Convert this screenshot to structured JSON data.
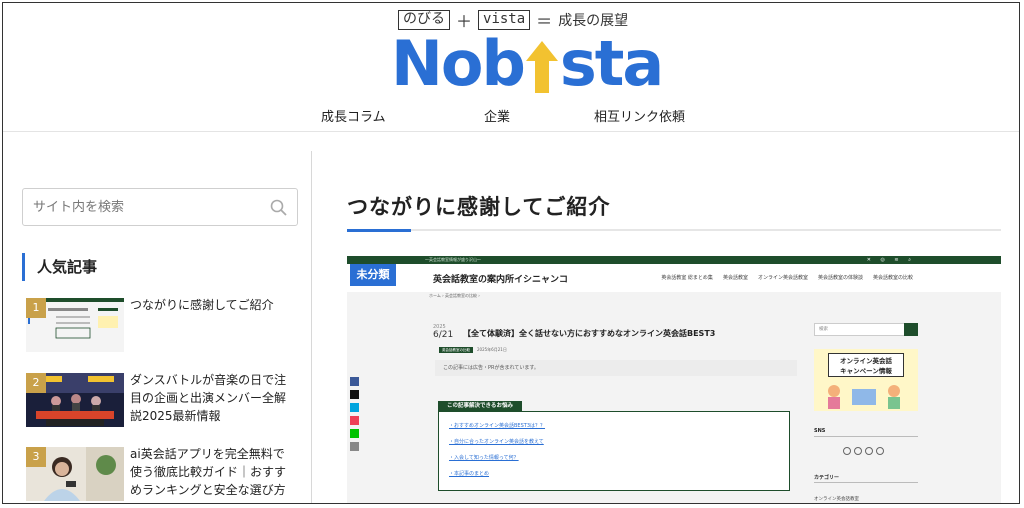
{
  "header": {
    "tagline": {
      "part1": "のびる",
      "plus": "＋",
      "part2": "vista",
      "equals": "＝",
      "part3": "成長の展望"
    },
    "logo": {
      "left": "Nob",
      "right": "sta"
    },
    "nav": [
      "成長コラム",
      "企業",
      "相互リンク依頼"
    ]
  },
  "sidebar": {
    "search_placeholder": "サイト内を検索",
    "popular_title": "人気記事",
    "popular": [
      {
        "rank": "1",
        "title": "つながりに感謝してご紹介"
      },
      {
        "rank": "2",
        "title": "ダンスバトルが音楽の日で注目の企画と出演メンバー全解説2025最新情報"
      },
      {
        "rank": "3",
        "title": "ai英会話アプリを完全無料で使う徹底比較ガイド｜おすすめランキングと安全な選び方"
      }
    ]
  },
  "main": {
    "title": "つながりに感謝してご紹介"
  },
  "embedded_screenshot": {
    "top_text": "〜英会話教室情報が盛り沢山〜",
    "badge": "未分類",
    "site_name": "英会話教室の案内所イシニャンコ",
    "menu": [
      "英会話教室 総まとめ集",
      "英会話教室",
      "オンライン英会話教室",
      "英会話教室の体験談",
      "英会話教室の比較"
    ],
    "breadcrumb": "ホーム › 英会話教室の比較 ›",
    "date_year": "2025",
    "date": "6/21",
    "article_title": "【全て体験済】全く話せない方におすすめなオンライン英会話BEST3",
    "category": "英会話教室の比較",
    "updated": "2025年6月21日",
    "note": "この記事には広告・PRが含まれています。",
    "toc_title": "この記事解決できるお悩み",
    "toc": [
      "・おすすめオンライン英会話BEST3は？？",
      "・自分に合ったオンライン英会話を教えて",
      "・入会して知った情報って何？",
      "・本記事のまとめ"
    ],
    "side_search": "検索",
    "banner_line1": "オンライン英会話",
    "banner_line2": "キャンペーン情報",
    "sns_title": "SNS",
    "category_title": "カテゴリー",
    "category_item": "オンライン英会話教室"
  },
  "colors": {
    "brand_blue": "#2a6fd4",
    "accent_gold": "#c9a14a",
    "embedded_green": "#1e4d2b"
  }
}
